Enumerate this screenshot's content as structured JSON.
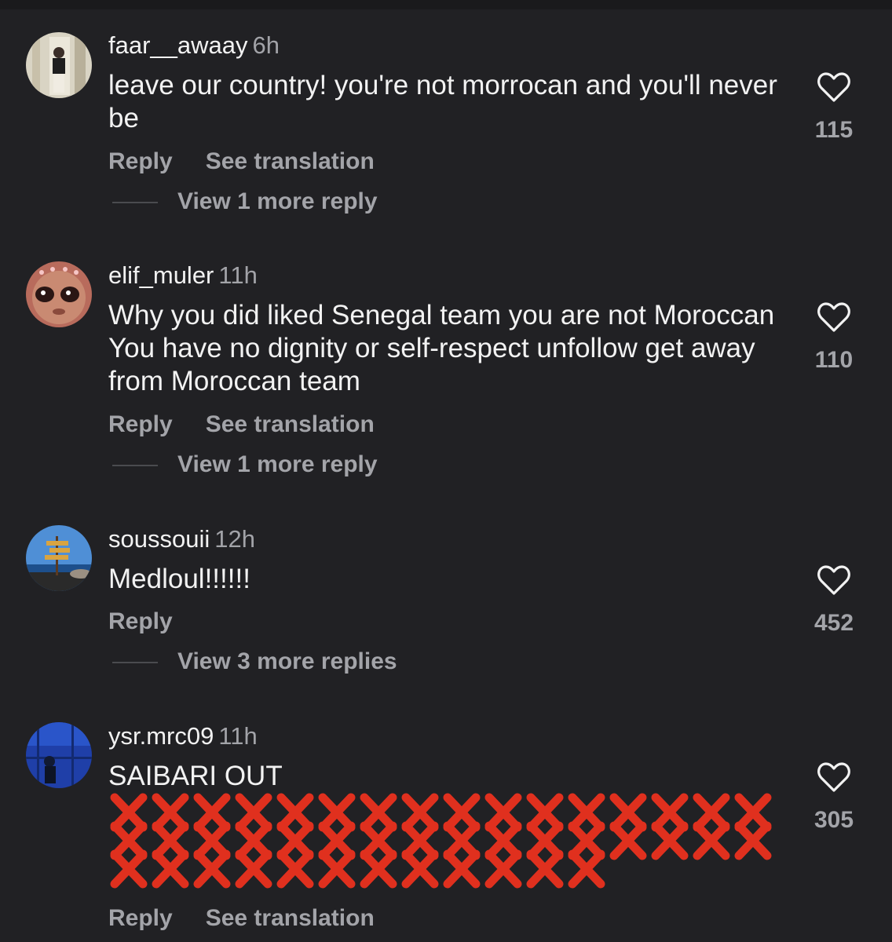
{
  "comments": [
    {
      "username": "faar__awaay",
      "time": "6h",
      "text": "leave our country! you're not morrocan and you'll never be",
      "reply_label": "Reply",
      "translate_label": "See translation",
      "more_replies": "View 1 more reply",
      "likes": "115"
    },
    {
      "username": "elif_muler",
      "time": "11h",
      "text": "Why you did liked Senegal team you are not Moroccan You have no dignity or self-respect unfollow get away from Moroccan team",
      "reply_label": "Reply",
      "translate_label": "See translation",
      "more_replies": "View 1 more reply",
      "likes": "110"
    },
    {
      "username": "soussouii",
      "time": "12h",
      "text": "Medloul!!!!!!",
      "reply_label": "Reply",
      "more_replies": "View 3 more replies",
      "likes": "452"
    },
    {
      "username": "ysr.mrc09",
      "time": "11h",
      "text": "SAIBARI OUT",
      "emoji": "cross-mark-emoji",
      "emoji_count": 44,
      "reply_label": "Reply",
      "translate_label": "See translation",
      "likes": "305"
    }
  ],
  "colors": {
    "background": "#212124",
    "text": "#f2f2f2",
    "muted": "#a3a4a9",
    "cross": "#e0301e"
  }
}
